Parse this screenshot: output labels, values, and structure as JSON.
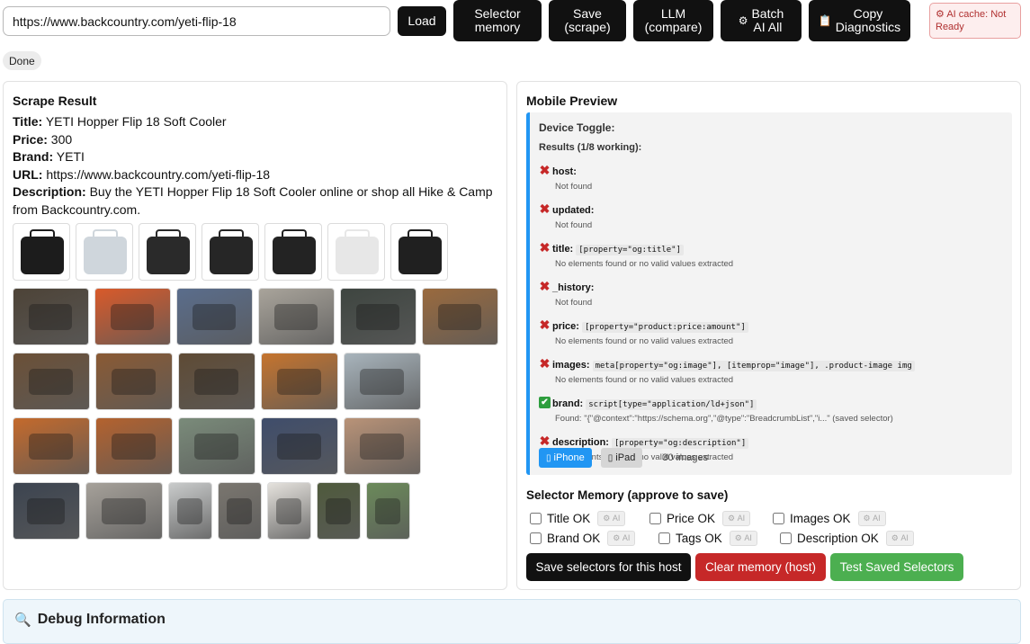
{
  "toolbar": {
    "url_value": "https://www.backcountry.com/yeti-flip-18",
    "load_label": "Load",
    "selector_memory_label": "Selector\nmemory",
    "save_label": "Save\n(scrape)",
    "llm_label": "LLM\n(compare)",
    "batch_label": "Batch\nAI All",
    "copy_label": "Copy\nDiagnostics",
    "ai_cache_label": "AI cache: Not Ready"
  },
  "status": "Done",
  "scrape": {
    "heading": "Scrape Result",
    "title_label": "Title:",
    "title_value": " YETI Hopper Flip 18 Soft Cooler",
    "price_label": "Price:",
    "price_value": " 300",
    "brand_label": "Brand:",
    "brand_value": " YETI",
    "url_label": "URL:",
    "url_value": " https://www.backcountry.com/yeti-flip-18",
    "description_label": "Description:",
    "description_value": " Buy the YETI Hopper Flip 18 Soft Cooler online or shop all Hike & Camp from Backcountry.com."
  },
  "gallery": {
    "thumb_colors": [
      [
        "#1c1c1c",
        "#cfd6dc",
        "#2a2a2a",
        "#262626",
        "#232323",
        "#e7e7e7",
        "#202020"
      ],
      [
        "#4d4337",
        "#d95a2a",
        "#5a6d8c",
        "#a9a49b",
        "#3e4540",
        "#9a6a3e"
      ],
      [
        "#6b5037",
        "#8a5a34",
        "#5f4b35",
        "#c5742e",
        "#a8b4bc"
      ],
      [
        "#c46a2c",
        "#b4622e",
        "#7a8b7a",
        "#3f4d6b",
        "#b99378"
      ],
      [
        "#3c4450",
        "#a6a19a",
        "#c9cbcb",
        "#7a766f",
        "#e5e2dd",
        "#4f5a3c",
        "#6b8a5a"
      ]
    ]
  },
  "preview": {
    "heading": "Mobile Preview",
    "device_toggle_label": "Device Toggle:",
    "results_label": "Results (1/8 working):",
    "results": [
      {
        "ok": false,
        "key": "host:",
        "selector": "",
        "message": "Not found"
      },
      {
        "ok": false,
        "key": "updated:",
        "selector": "",
        "message": "Not found"
      },
      {
        "ok": false,
        "key": "title:",
        "selector": "[property=\"og:title\"]",
        "message": "No elements found or no valid values extracted"
      },
      {
        "ok": false,
        "key": "_history:",
        "selector": "",
        "message": "Not found"
      },
      {
        "ok": false,
        "key": "price:",
        "selector": "[property=\"product:price:amount\"]",
        "message": "No elements found or no valid values extracted"
      },
      {
        "ok": false,
        "key": "images:",
        "selector": "meta[property=\"og:image\"], [itemprop=\"image\"], .product-image img",
        "message": "No elements found or no valid values extracted"
      },
      {
        "ok": true,
        "key": "brand:",
        "selector": "script[type=\"application/ld+json\"]",
        "message": "Found: \"{\"@context\":\"https://schema.org\",\"@type\":\"BreadcrumbList\",\"i...\" (saved selector)"
      },
      {
        "ok": false,
        "key": "description:",
        "selector": "[property=\"og:description\"]",
        "message": "No elements found or no valid values extracted"
      }
    ],
    "iphone_label": "iPhone",
    "ipad_label": "iPad",
    "images_count": "30 images"
  },
  "memory": {
    "heading": "Selector Memory (approve to save)",
    "row1": [
      "Title OK",
      "Price OK",
      "Images OK"
    ],
    "row2": [
      "Brand OK",
      "Tags OK",
      "Description OK"
    ],
    "ai_chip": "AI",
    "save_btn": "Save selectors for this host",
    "clear_btn": "Clear memory (host)",
    "test_btn": "Test Saved Selectors"
  },
  "debug": {
    "title": "Debug Information"
  },
  "colors": {
    "accent_blue": "#2196f3",
    "danger": "#c62828",
    "success": "#4caf50",
    "dark": "#111111"
  }
}
